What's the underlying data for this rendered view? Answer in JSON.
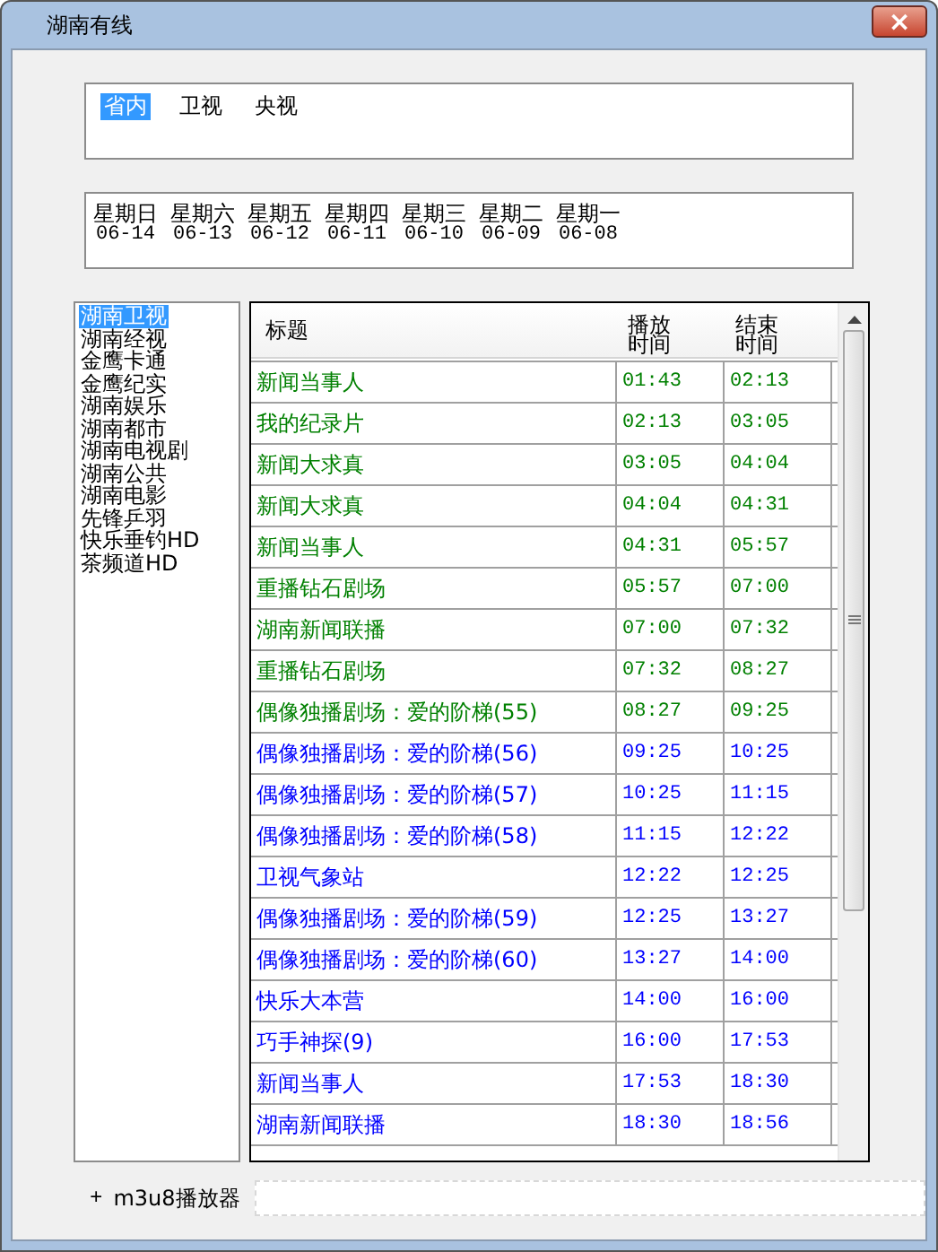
{
  "window": {
    "title": "湖南有线",
    "close": "×"
  },
  "tabs": [
    {
      "label": "省内",
      "selected": true
    },
    {
      "label": "卫视",
      "selected": false
    },
    {
      "label": "央视",
      "selected": false
    }
  ],
  "dates": [
    {
      "weekday": "星期日",
      "date": "06-14"
    },
    {
      "weekday": "星期六",
      "date": "06-13"
    },
    {
      "weekday": "星期五",
      "date": "06-12"
    },
    {
      "weekday": "星期四",
      "date": "06-11"
    },
    {
      "weekday": "星期三",
      "date": "06-10"
    },
    {
      "weekday": "星期二",
      "date": "06-09"
    },
    {
      "weekday": "星期一",
      "date": "06-08"
    }
  ],
  "channels": [
    {
      "name": "湖南卫视",
      "selected": true
    },
    {
      "name": "湖南经视",
      "selected": false
    },
    {
      "name": "金鹰卡通",
      "selected": false
    },
    {
      "name": "金鹰纪实",
      "selected": false
    },
    {
      "name": "湖南娱乐",
      "selected": false
    },
    {
      "name": "湖南都市",
      "selected": false
    },
    {
      "name": "湖南电视剧",
      "selected": false
    },
    {
      "name": "湖南公共",
      "selected": false
    },
    {
      "name": "湖南电影",
      "selected": false
    },
    {
      "name": "先锋乒羽",
      "selected": false
    },
    {
      "name": "快乐垂钓HD",
      "selected": false
    },
    {
      "name": "茶频道HD",
      "selected": false
    }
  ],
  "programs": {
    "columns": [
      "标题",
      "播放时间",
      "结束时间"
    ],
    "rows": [
      {
        "title": "新闻当事人",
        "start": "01:43",
        "end": "02:13",
        "color": "#008000"
      },
      {
        "title": "我的纪录片",
        "start": "02:13",
        "end": "03:05",
        "color": "#008000"
      },
      {
        "title": "新闻大求真",
        "start": "03:05",
        "end": "04:04",
        "color": "#008000"
      },
      {
        "title": "新闻大求真",
        "start": "04:04",
        "end": "04:31",
        "color": "#008000"
      },
      {
        "title": "新闻当事人",
        "start": "04:31",
        "end": "05:57",
        "color": "#008000"
      },
      {
        "title": "重播钻石剧场",
        "start": "05:57",
        "end": "07:00",
        "color": "#008000"
      },
      {
        "title": "湖南新闻联播",
        "start": "07:00",
        "end": "07:32",
        "color": "#008000"
      },
      {
        "title": "重播钻石剧场",
        "start": "07:32",
        "end": "08:27",
        "color": "#008000"
      },
      {
        "title": "偶像独播剧场：爱的阶梯(55)",
        "start": "08:27",
        "end": "09:25",
        "color": "#008000"
      },
      {
        "title": "偶像独播剧场：爱的阶梯(56)",
        "start": "09:25",
        "end": "10:25",
        "color": "#0000ff"
      },
      {
        "title": "偶像独播剧场：爱的阶梯(57)",
        "start": "10:25",
        "end": "11:15",
        "color": "#0000ff"
      },
      {
        "title": "偶像独播剧场：爱的阶梯(58)",
        "start": "11:15",
        "end": "12:22",
        "color": "#0000ff"
      },
      {
        "title": "卫视气象站",
        "start": "12:22",
        "end": "12:25",
        "color": "#0000ff"
      },
      {
        "title": "偶像独播剧场：爱的阶梯(59)",
        "start": "12:25",
        "end": "13:27",
        "color": "#0000ff"
      },
      {
        "title": "偶像独播剧场：爱的阶梯(60)",
        "start": "13:27",
        "end": "14:00",
        "color": "#0000ff"
      },
      {
        "title": "快乐大本营",
        "start": "14:00",
        "end": "16:00",
        "color": "#0000ff"
      },
      {
        "title": "巧手神探(9)",
        "start": "16:00",
        "end": "17:53",
        "color": "#0000ff"
      },
      {
        "title": "新闻当事人",
        "start": "17:53",
        "end": "18:30",
        "color": "#0000ff"
      },
      {
        "title": "湖南新闻联播",
        "start": "18:30",
        "end": "18:56",
        "color": "#0000ff"
      }
    ]
  },
  "player": {
    "plus": "+",
    "label": "m3u8播放器"
  }
}
